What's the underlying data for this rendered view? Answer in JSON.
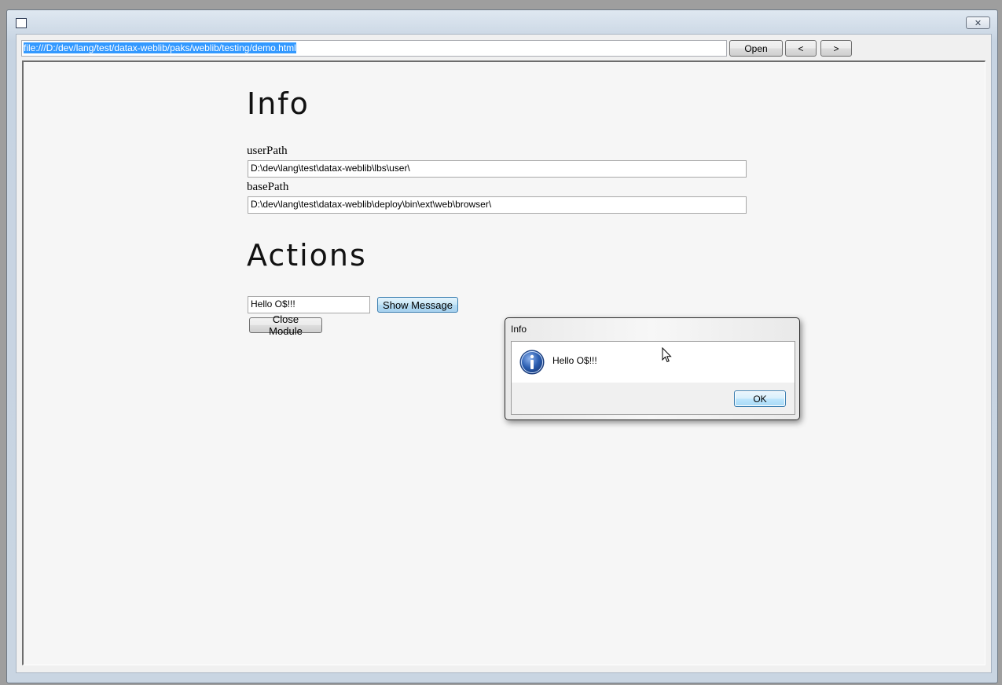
{
  "window": {
    "close_glyph": "✕"
  },
  "toolbar": {
    "url": "file:///D:/dev/lang/test/datax-weblib/paks/weblib/testing/demo.html",
    "open_label": "Open",
    "back_label": "<",
    "forward_label": ">"
  },
  "page": {
    "info_heading": "Info",
    "user_path_label": "userPath",
    "user_path_value": "D:\\dev\\lang\\test\\datax-weblib\\lbs\\user\\",
    "base_path_label": "basePath",
    "base_path_value": "D:\\dev\\lang\\test\\datax-weblib\\deploy\\bin\\ext\\web\\browser\\",
    "actions_heading": "Actions",
    "message_value": "Hello O$!!!",
    "show_message_label": "Show Message",
    "close_module_label": "Close Module"
  },
  "dialog": {
    "title": "Info",
    "message": "Hello O$!!!",
    "ok_label": "OK",
    "icon": "info-icon"
  },
  "colors": {
    "selection": "#3399ff",
    "content_bg": "#f6f6f6",
    "info_icon": "#2a5db0"
  }
}
